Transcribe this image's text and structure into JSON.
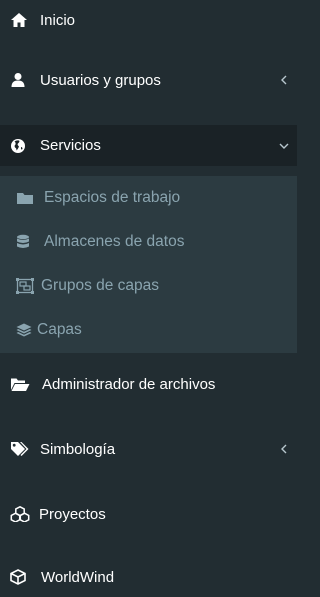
{
  "menu": {
    "inicio": {
      "label": "Inicio",
      "icon": "home-icon"
    },
    "usuarios": {
      "label": "Usuarios y grupos",
      "icon": "user-icon",
      "chevron": "chevron-left-icon"
    },
    "servicios": {
      "label": "Servicios",
      "icon": "globe-icon",
      "chevron": "chevron-down-icon"
    },
    "sub": [
      {
        "label": "Espacios de trabajo",
        "icon": "folder-icon"
      },
      {
        "label": "Almacenes de datos",
        "icon": "database-icon"
      },
      {
        "label": "Grupos de capas",
        "icon": "object-group-icon"
      },
      {
        "label": "Capas",
        "icon": "layers-icon"
      }
    ],
    "archivos": {
      "label": "Administrador de archivos",
      "icon": "folder-open-icon"
    },
    "simbologia": {
      "label": "Simbología",
      "icon": "tags-icon",
      "chevron": "chevron-left-icon"
    },
    "proyectos": {
      "label": "Proyectos",
      "icon": "cubes-icon"
    },
    "worldwind": {
      "label": "WorldWind",
      "icon": "cube-icon"
    }
  },
  "colors": {
    "bg": "#222d32",
    "active_bg": "#1a2226",
    "submenu_bg": "#2c3b41",
    "sub_text": "#8aa4af"
  }
}
